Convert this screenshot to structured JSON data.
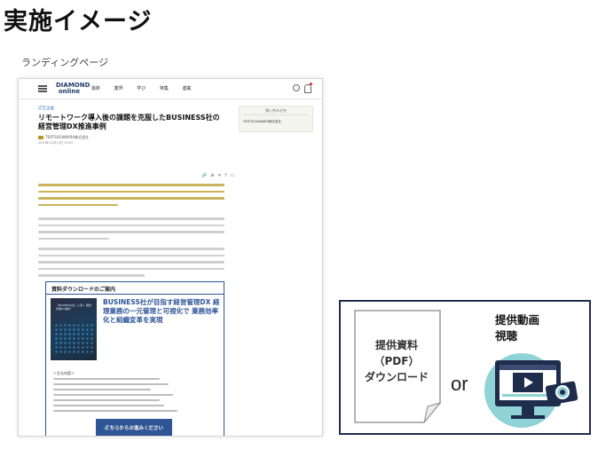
{
  "page": {
    "title": "実施イメージ",
    "section_label": "ランディングページ"
  },
  "mock_page": {
    "logo": "DIAMOND\nonline",
    "nav": [
      "最新",
      "業界",
      "学び",
      "特集",
      "連載"
    ],
    "category": "広告企画",
    "headline": "リモートワーク導入後の課題を克服したBUSINESS社の経営管理DX推進事例",
    "author": "TEXTSUGAWARA株式会社",
    "date": "2024年12月13日 10:00",
    "download_box": {
      "title": "資料ダウンロードのご案内",
      "heading": "BUSINESS社が目指す経営管理DX 経理業務の一元管理と可視化で 業務効率化と組織変革を実現",
      "book_title": "「BUSINESS社」に導く 経営管理DX事例",
      "points_title": "＜主な内容＞",
      "cta": "こちらからお進みください"
    },
    "side_box": {
      "title": "問い合わせ先",
      "company": "TEXTSUGAWARA株式会社"
    }
  },
  "offer": {
    "document_label": "提供資料\n（PDF）\nダウンロード",
    "or_text": "or",
    "video_label": "提供動画\n視聴"
  },
  "colors": {
    "accent_blue": "#2f5597",
    "gold": "#c9b45a",
    "panel_border": "#1f2d4d",
    "teal": "#8fd3d6"
  }
}
